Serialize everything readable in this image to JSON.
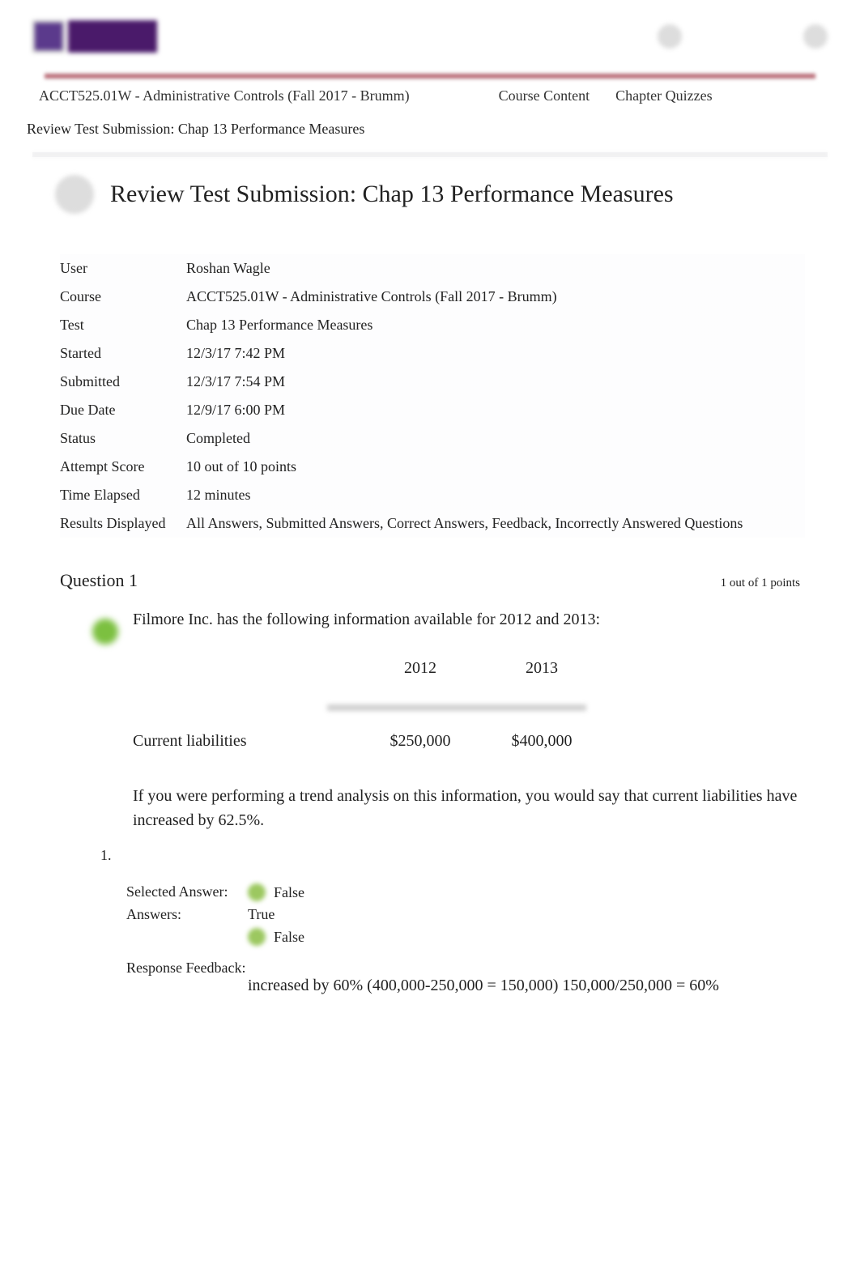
{
  "breadcrumb": {
    "course": "ACCT525.01W - Administrative Controls (Fall 2017 - Brumm)",
    "content": "Course Content",
    "quizzes": "Chapter Quizzes"
  },
  "page_subtitle": "Review Test Submission: Chap 13 Performance Measures",
  "page_title": "Review Test Submission: Chap 13 Performance Measures",
  "info": {
    "user_label": "User",
    "user_value": "Roshan Wagle",
    "course_label": "Course",
    "course_value": "ACCT525.01W - Administrative Controls (Fall 2017 - Brumm)",
    "test_label": "Test",
    "test_value": "Chap 13 Performance Measures",
    "started_label": "Started",
    "started_value": "12/3/17 7:42 PM",
    "submitted_label": "Submitted",
    "submitted_value": "12/3/17 7:54 PM",
    "due_label": "Due Date",
    "due_value": "12/9/17 6:00 PM",
    "status_label": "Status",
    "status_value": "Completed",
    "score_label": "Attempt Score",
    "score_value": "10 out of 10 points",
    "elapsed_label": "Time Elapsed",
    "elapsed_value": "12 minutes",
    "results_label": "Results Displayed",
    "results_value": "All Answers, Submitted Answers, Correct Answers, Feedback, Incorrectly Answered Questions"
  },
  "question": {
    "title": "Question 1",
    "points": "1 out of 1 points",
    "stem": "Filmore Inc. has the following information available for 2012 and 2013:",
    "table": {
      "col1": "2012",
      "col2": "2013",
      "row_label": "Current liabilities",
      "row_v1": "$250,000",
      "row_v2": "$400,000"
    },
    "followup": "If you were performing a trend analysis on this information, you would say that current liabilities have increased by 62.5%.",
    "list_num": "1.",
    "selected_label": "Selected Answer:",
    "selected_value": "False",
    "answers_label": "Answers:",
    "answer_true": "True",
    "answer_false": "False",
    "feedback_label": "Response Feedback:",
    "feedback_text": "increased by 60% (400,000-250,000 = 150,000) 150,000/250,000 = 60%"
  }
}
